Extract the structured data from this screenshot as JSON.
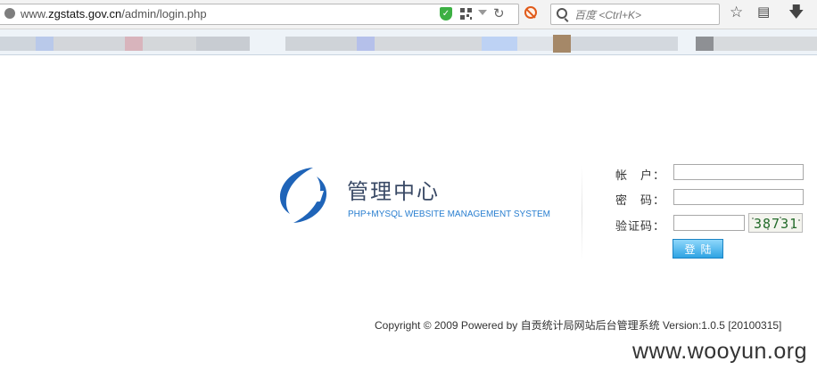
{
  "browser": {
    "url_prefix": "www.",
    "url_domain": "zgstats.gov.cn",
    "url_path": "/admin/login.php",
    "search_placeholder": "百度 <Ctrl+K>"
  },
  "logo": {
    "title": "管理中心",
    "subtitle": "PHP+MYSQL WEBSITE MANAGEMENT SYSTEM"
  },
  "login": {
    "account_label": "帐　户：",
    "password_label": "密　码：",
    "captcha_label": "验证码：",
    "captcha_text": "38731",
    "submit_label": "登陆"
  },
  "footer": {
    "copyright": "Copyright © 2009 Powered by 自贡统计局网站后台管理系统 Version:1.0.5 [20100315]"
  },
  "watermark": "www.wooyun.org"
}
